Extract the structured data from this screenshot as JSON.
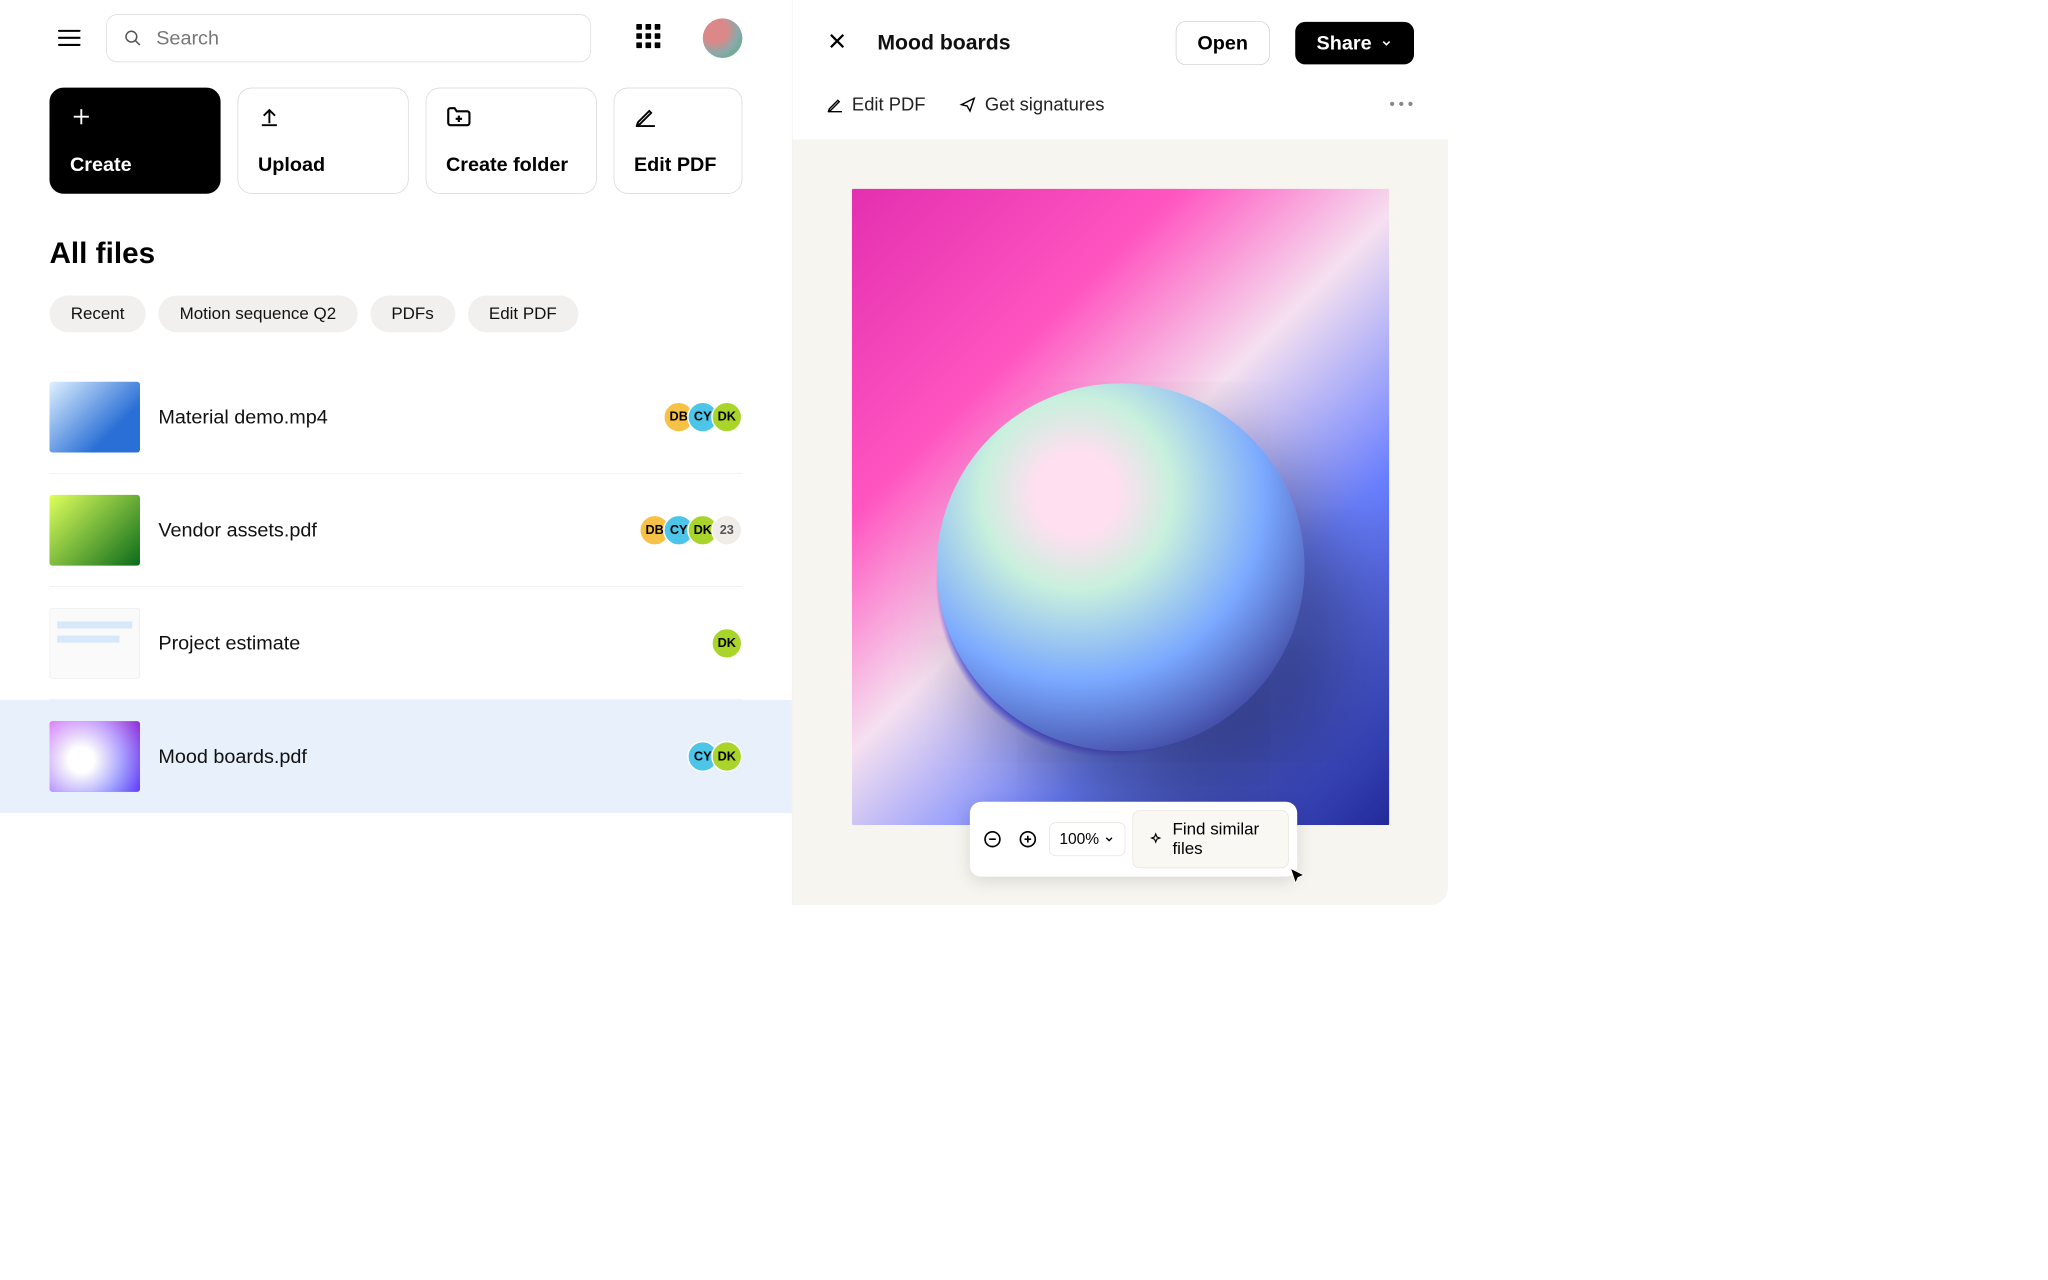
{
  "search": {
    "placeholder": "Search"
  },
  "actions": {
    "create": "Create",
    "upload": "Upload",
    "create_folder": "Create folder",
    "edit_pdf": "Edit PDF"
  },
  "section_title": "All files",
  "chips": [
    "Recent",
    "Motion sequence Q2",
    "PDFs",
    "Edit PDF"
  ],
  "files": [
    {
      "name": "Material demo.mp4",
      "shared": [
        "DB",
        "CY",
        "DK"
      ],
      "extra": null,
      "thumb": "blue"
    },
    {
      "name": "Vendor assets.pdf",
      "shared": [
        "DB",
        "CY",
        "DK"
      ],
      "extra": "23",
      "thumb": "green"
    },
    {
      "name": "Project estimate",
      "shared": [
        "DK"
      ],
      "extra": null,
      "thumb": "doc"
    },
    {
      "name": "Mood boards.pdf",
      "shared": [
        "CY",
        "DK"
      ],
      "extra": null,
      "thumb": "sphere",
      "selected": true
    }
  ],
  "preview": {
    "title": "Mood boards",
    "open": "Open",
    "share": "Share",
    "tool_edit": "Edit PDF",
    "tool_sign": "Get signatures",
    "zoom": "100%",
    "find_similar": "Find similar files"
  }
}
